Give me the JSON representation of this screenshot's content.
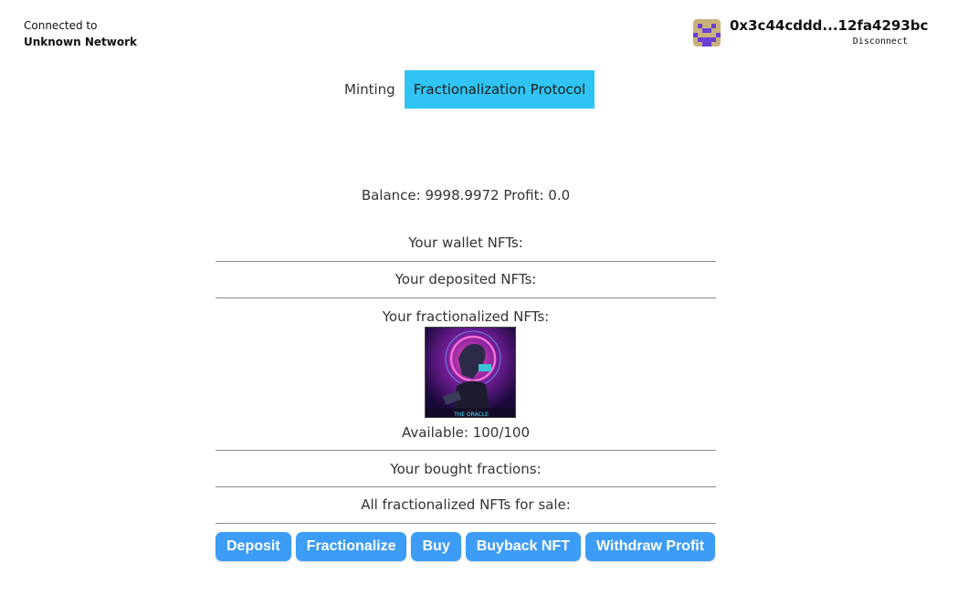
{
  "connection": {
    "label": "Connected to",
    "network": "Unknown Network"
  },
  "account": {
    "address": "0x3c44cddd...12fa4293bc",
    "disconnect_label": "Disconnect",
    "avatar_icon": "pixel-avatar-icon"
  },
  "tabs": [
    {
      "label": "Minting",
      "active": false
    },
    {
      "label": "Fractionalization Protocol",
      "active": true
    }
  ],
  "colors": {
    "accent": "#2fc4f3",
    "button": "#3d9cf5"
  },
  "balance_line": "Balance: 9998.9972 Profit: 0.0",
  "sections": {
    "wallet": "Your wallet NFTs:",
    "deposited": "Your deposited NFTs:",
    "fractionalized": "Your fractionalized NFTs:",
    "bought": "Your bought fractions:",
    "for_sale": "All fractionalized NFTs for sale:"
  },
  "fractionalized_nft": {
    "available": "Available: 100/100",
    "image_caption": "THE ORACLE"
  },
  "actions": [
    "Deposit",
    "Fractionalize",
    "Buy",
    "Buyback NFT",
    "Withdraw Profit"
  ]
}
